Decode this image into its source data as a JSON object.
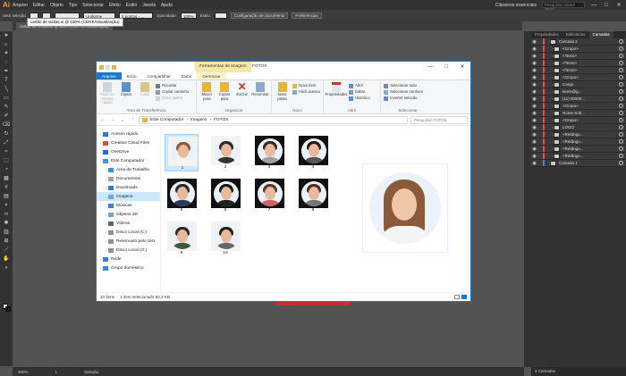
{
  "illustrator": {
    "logo": "Ai",
    "menu": [
      "Arquivo",
      "Editar",
      "Objeto",
      "Tipo",
      "Selecionar",
      "Efeito",
      "Exibir",
      "Janela",
      "Ajuda"
    ],
    "workspace": "Clássicos essenciais",
    "search_placeholder": "Pesquisar Adobe Stock",
    "window_controls": [
      "—",
      "□",
      "✕"
    ],
    "control_bar": {
      "selection": "Sem seleção",
      "stroke_style": "Uniforme",
      "brush": "5 pontos - ...",
      "opacity_label": "Opacidade:",
      "opacity_value": "100%",
      "style_label": "Estilo:",
      "doc_setup": "Configuração de documento",
      "preferences": "Preferências"
    },
    "tooltip": "cartão de visitas.ai @ 100% (CMYK/Visualização)",
    "doc_tab": "cartão de visitas.ai @ 300% (CMYK/Visualização)",
    "status": {
      "zoom": "300%",
      "page": "1",
      "mode": "Seleção"
    },
    "layers": {
      "tabs": [
        "Propriedades",
        "Bibliotecas",
        "Camadas"
      ],
      "rows": [
        {
          "name": "Camada 2",
          "color": "#e84a4a",
          "indent": 0
        },
        {
          "name": "<Grupo>",
          "color": "#e84a4a",
          "indent": 1
        },
        {
          "name": "<Texto>",
          "color": "#e84a4a",
          "indent": 1
        },
        {
          "name": "<Texto>",
          "color": "#e84a4a",
          "indent": 1
        },
        {
          "name": "<Texto>",
          "color": "#e84a4a",
          "indent": 1
        },
        {
          "name": "<Grupo>",
          "color": "#e84a4a",
          "indent": 1
        },
        {
          "name": "Cargo",
          "color": "#e84a4a",
          "indent": 1
        },
        {
          "name": "kevin@g...",
          "color": "#e84a4a",
          "indent": 1
        },
        {
          "name": "(11) 00000...",
          "color": "#e84a4a",
          "indent": 1
        },
        {
          "name": "<Grupo>",
          "color": "#e84a4a",
          "indent": 1
        },
        {
          "name": "Nome Sob...",
          "color": "#e84a4a",
          "indent": 1
        },
        {
          "name": "<Grupo>",
          "color": "#e84a4a",
          "indent": 1
        },
        {
          "name": "LOGO",
          "color": "#e84a4a",
          "indent": 1
        },
        {
          "name": "<Retângu...",
          "color": "#e84a4a",
          "indent": 1
        },
        {
          "name": "<Retângu...",
          "color": "#e84a4a",
          "indent": 1
        },
        {
          "name": "<Retângu...",
          "color": "#e84a4a",
          "indent": 1
        },
        {
          "name": "<Retângu...",
          "color": "#e84a4a",
          "indent": 1
        },
        {
          "name": "Camada 1",
          "color": "#4a7fe8",
          "indent": 0
        }
      ],
      "footer": "2 Camadas"
    }
  },
  "explorer": {
    "context_tab": "Ferramentas de Imagem",
    "title": "FOTOS",
    "window_controls": [
      "—",
      "□",
      "✕"
    ],
    "ribbon_tabs": [
      "Arquivo",
      "Início",
      "Compartilhar",
      "Exibir",
      "Gerenciar"
    ],
    "ribbon": {
      "pin": "Fixar no Acesso rápido",
      "copy": "Copiar",
      "paste": "Colar",
      "cut": "Recortar",
      "copy_path": "Copiar caminho",
      "paste_shortcut": "Colar atalho",
      "clipboard_label": "Área de Transferência",
      "move": "Mover para",
      "copy_to": "Copiar para",
      "delete": "Excluir",
      "rename": "Renomear",
      "organize_label": "Organizar",
      "new_folder": "Nova pasta",
      "new_item": "Novo item",
      "easy_access": "Fácil acesso",
      "new_label": "Novo",
      "properties": "Propriedades",
      "open": "Abrir",
      "edit": "Editar",
      "history": "Histórico",
      "open_label": "Abrir",
      "select_all": "Selecionar tudo",
      "select_none": "Selecionar nenhum",
      "invert": "Inverter seleção",
      "select_label": "Selecionar"
    },
    "breadcrumb": [
      "Este Computador",
      "Imagens",
      "FOTOS"
    ],
    "search_placeholder": "Pesquisar FOTOS",
    "nav": [
      {
        "label": "Acesso rápido",
        "icon": "#2b7bd6",
        "level": 0
      },
      {
        "label": "Creative Cloud Files",
        "icon": "#d94a3a",
        "level": 0
      },
      {
        "label": "OneDrive",
        "icon": "#1f6fd0",
        "level": 0
      },
      {
        "label": "Este Computador",
        "icon": "#4a90d9",
        "level": 0
      },
      {
        "label": "Área de Trabalho",
        "icon": "#3d8fd6",
        "level": 1
      },
      {
        "label": "Documentos",
        "icon": "#9aa4ae",
        "level": 1
      },
      {
        "label": "Downloads",
        "icon": "#2f7fd0",
        "level": 1
      },
      {
        "label": "Imagens",
        "icon": "#6aa7e0",
        "level": 1,
        "selected": true
      },
      {
        "label": "Músicas",
        "icon": "#3a7fd0",
        "level": 1
      },
      {
        "label": "Objetos 3D",
        "icon": "#6aa7e0",
        "level": 1
      },
      {
        "label": "Vídeos",
        "icon": "#5b6770",
        "level": 1
      },
      {
        "label": "Disco Local (C:)",
        "icon": "#8a949e",
        "level": 1
      },
      {
        "label": "Reservado pelo Sist",
        "icon": "#8a949e",
        "level": 1
      },
      {
        "label": "Disco Local (G:)",
        "icon": "#8a949e",
        "level": 1
      },
      {
        "label": "Rede",
        "icon": "#3a7fd0",
        "level": 0
      },
      {
        "label": "Grupo doméstico",
        "icon": "#2f8fd0",
        "level": 0
      }
    ],
    "files": [
      {
        "label": "1",
        "bg": "light",
        "hair": "#8a5a3a",
        "shirt": "#f4f4f4",
        "selected": true
      },
      {
        "label": "2",
        "bg": "light",
        "hair": "#2a2a2a",
        "shirt": "#333"
      },
      {
        "label": "3",
        "bg": "dark",
        "hair": "#3a2a20",
        "shirt": "#a0a0a0"
      },
      {
        "label": "4",
        "bg": "dark",
        "hair": "#2a1a14",
        "shirt": "#555"
      },
      {
        "label": "5",
        "bg": "dark",
        "hair": "#2a2a2a",
        "shirt": "#2a3a5a"
      },
      {
        "label": "6",
        "bg": "dark",
        "hair": "#1a1a1a",
        "shirt": "#222"
      },
      {
        "label": "7",
        "bg": "dark",
        "hair": "#5a3a24",
        "shirt": "#c66"
      },
      {
        "label": "8",
        "bg": "dark",
        "hair": "#4a3020",
        "shirt": "#777"
      },
      {
        "label": "9",
        "bg": "light",
        "hair": "#2a2a2a",
        "shirt": "#3a5a3a"
      },
      {
        "label": "10",
        "bg": "light",
        "hair": "#2a1a14",
        "shirt": "#666"
      }
    ],
    "status": {
      "count": "10 itens",
      "selection": "1 item selecionado  82,3 KB"
    }
  }
}
